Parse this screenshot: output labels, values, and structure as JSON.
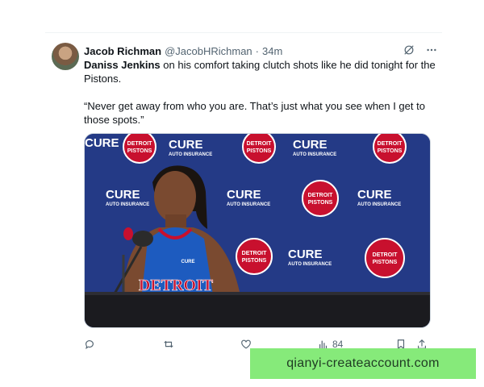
{
  "tweet": {
    "author_name": "Jacob Richman",
    "author_handle": "@JacobHRichman",
    "separator": "·",
    "time": "34m",
    "text_mention": "Daniss Jenkins",
    "text_rest": " on his comfort taking clutch shots like he did tonight for the Pistons.",
    "quote": "“Never get away from who you are. That’s just what you see when I get to those spots.”",
    "views": "84"
  },
  "media": {
    "banner_cure": "CURE",
    "banner_cure_sub": "AUTO INSURANCE",
    "banner_pistons_top": "DETROIT",
    "banner_pistons_bottom": "PISTONS",
    "jersey_text": "DETROIT",
    "jersey_patch": "CURE"
  },
  "watermark": {
    "text": "qianyi-createaccount.com"
  },
  "colors": {
    "backdrop": "#243a86",
    "pistons_red": "#c8102e",
    "jersey_blue": "#1d5bbf",
    "watermark_bg": "#86ea7a"
  },
  "icons": {
    "header": [
      "grok-icon",
      "more-icon"
    ],
    "actions": [
      "reply-icon",
      "retweet-icon",
      "like-icon",
      "views-icon",
      "bookmark-icon",
      "share-icon"
    ]
  }
}
